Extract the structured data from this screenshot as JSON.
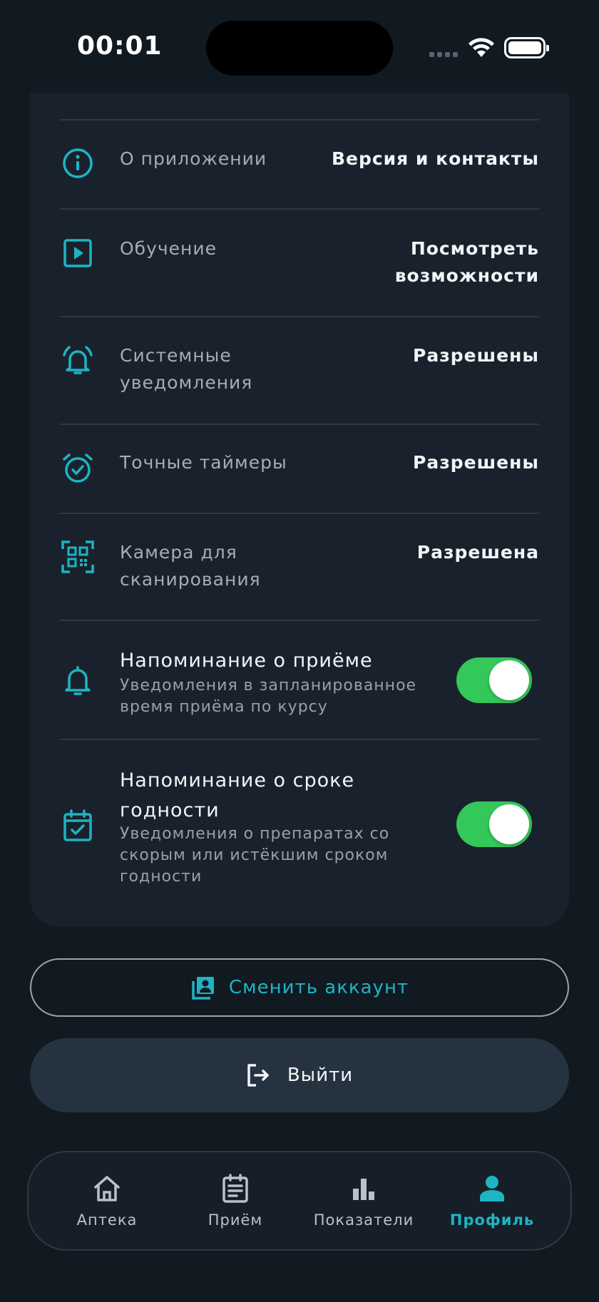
{
  "status_bar": {
    "time": "00:01"
  },
  "settings": {
    "about": {
      "label": "О приложении",
      "value": "Версия и контакты",
      "icon": "info-icon"
    },
    "tutorial": {
      "label": "Обучение",
      "value_line1": "Посмотреть",
      "value_line2": "возможности",
      "icon": "play-square-icon"
    },
    "system_notifications": {
      "label_line1": "Системные",
      "label_line2": "уведомления",
      "value": "Разрешены",
      "icon": "alarm-bell-icon"
    },
    "exact_timers": {
      "label": "Точные таймеры",
      "value": "Разрешены",
      "icon": "alarm-clock-check-icon"
    },
    "camera": {
      "label_line1": "Камера для",
      "label_line2": "сканирования",
      "value": "Разрешена",
      "icon": "qr-scan-icon"
    },
    "intake_reminder": {
      "title": "Напоминание о приёме",
      "subtitle_line1": "Уведомления в запланированное",
      "subtitle_line2": "время приёма по курсу",
      "enabled": true,
      "icon": "bell-icon"
    },
    "expiry_reminder": {
      "title_line1": "Напоминание о сроке",
      "title_line2": "годности",
      "subtitle_line1": "Уведомления о препаратах со",
      "subtitle_line2": "скорым или истёкшим сроком",
      "subtitle_line3": "годности",
      "enabled": true,
      "icon": "calendar-check-icon"
    }
  },
  "actions": {
    "switch_account": "Сменить аккаунт",
    "logout": "Выйти"
  },
  "tab_bar": {
    "tabs": [
      {
        "label": "Аптека",
        "icon": "home-icon"
      },
      {
        "label": "Приём",
        "icon": "clipboard-list-icon"
      },
      {
        "label": "Показатели",
        "icon": "bar-chart-icon"
      },
      {
        "label": "Профиль",
        "icon": "person-icon",
        "active": true
      }
    ]
  },
  "colors": {
    "background": "#111921",
    "card": "#19222c",
    "accent": "#1eb4c3",
    "toggle_on": "#34c759"
  }
}
